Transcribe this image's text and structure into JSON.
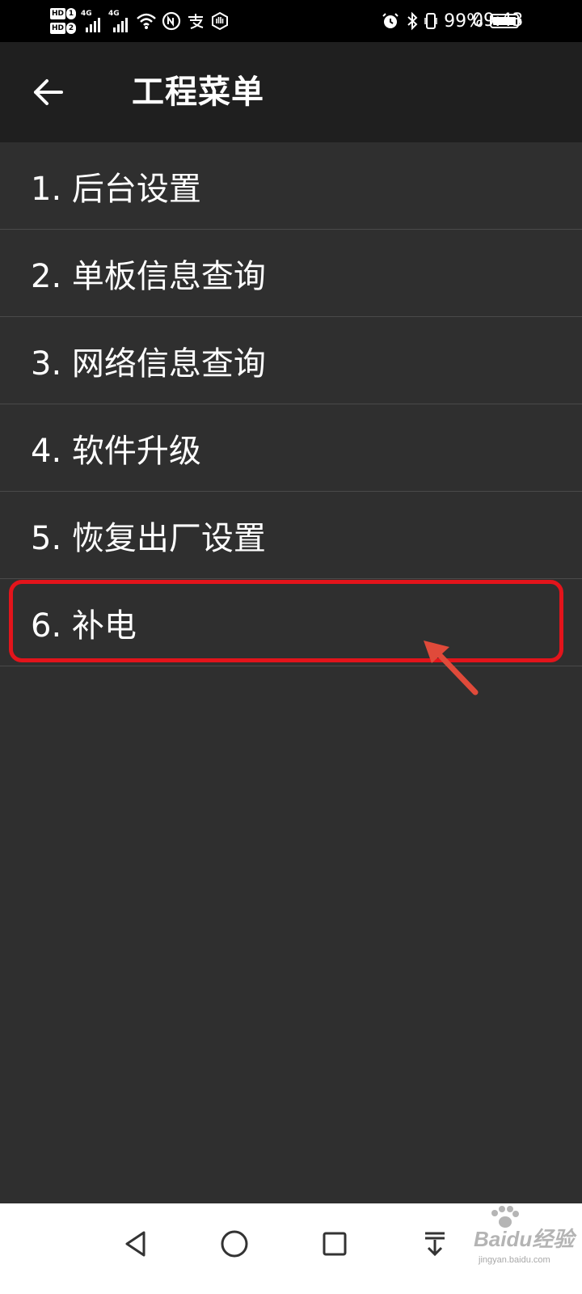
{
  "status_bar": {
    "hd1_label": "HD",
    "hd1_num": "1",
    "hd2_label": "HD",
    "hd2_num": "2",
    "net1": "4G",
    "net2": "4G",
    "battery_percent_text": "99%",
    "battery_level": 0.99,
    "time": "09:43",
    "icons": [
      "wifi-icon",
      "nfc-icon",
      "alipay-icon",
      "hand-icon",
      "alarm-icon",
      "bluetooth-icon",
      "vibrate-icon",
      "battery-icon"
    ]
  },
  "app_bar": {
    "title": "工程菜单",
    "back_icon": "arrow-left-icon"
  },
  "menu": {
    "items": [
      {
        "label": "1. 后台设置"
      },
      {
        "label": "2. 单板信息查询"
      },
      {
        "label": "3. 网络信息查询"
      },
      {
        "label": "4. 软件升级"
      },
      {
        "label": "5. 恢复出厂设置"
      },
      {
        "label": "6. 补电"
      }
    ],
    "highlighted_index": 5
  },
  "annotation": {
    "color": "#e3141b"
  },
  "nav_bar": {
    "icons": [
      "back-triangle-icon",
      "home-circle-icon",
      "recents-square-icon",
      "notification-pulldown-icon"
    ]
  },
  "watermark": {
    "main": "Baidu经验",
    "sub": "jingyan.baidu.com"
  }
}
